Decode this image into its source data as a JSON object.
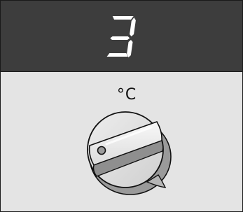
{
  "display": {
    "value": "3",
    "background": "#3d3d3d",
    "segment_color": "#ffffff"
  },
  "control": {
    "unit_label": "°C",
    "knob_icon": "rotary-knob",
    "indicator_icon": "dot-indicator",
    "panel_background": "#e4e4e4"
  }
}
